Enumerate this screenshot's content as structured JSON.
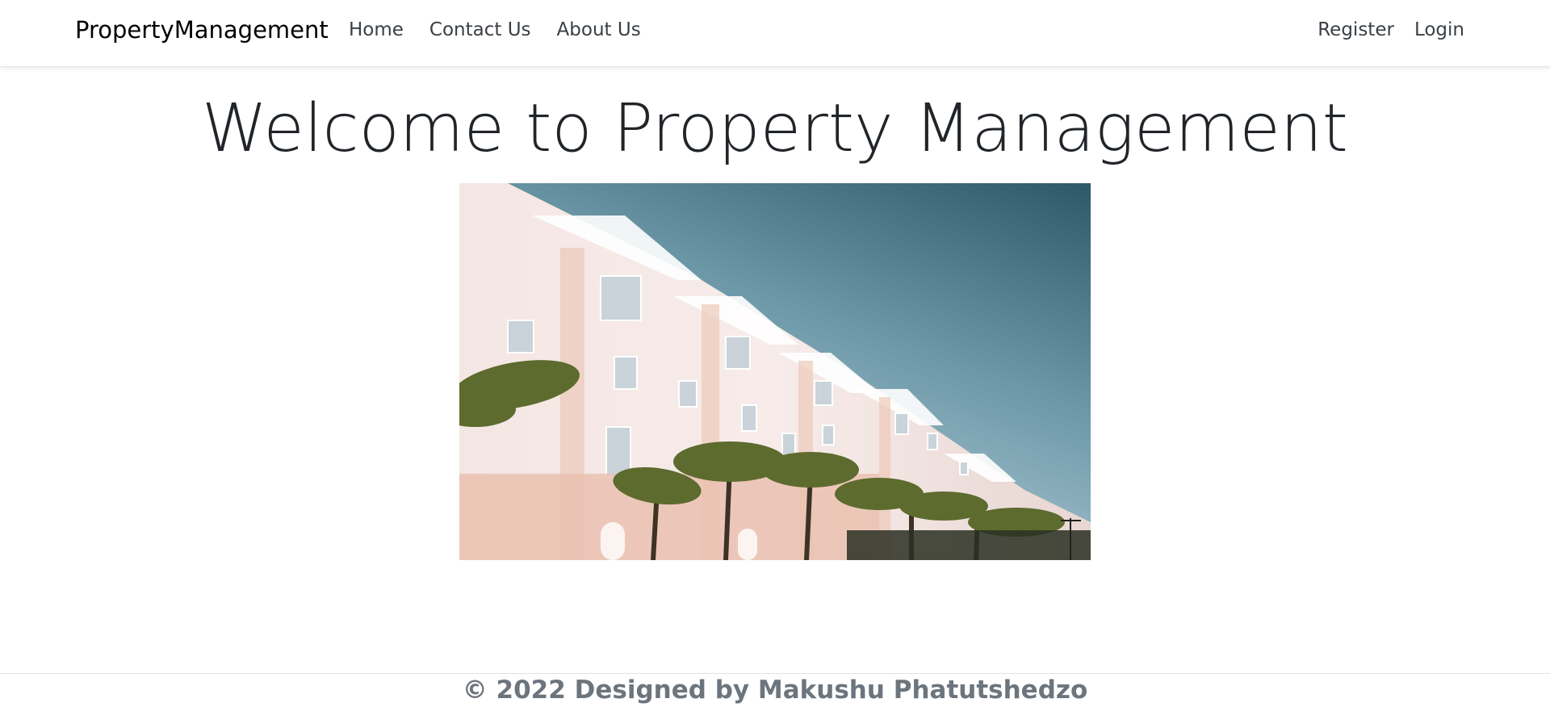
{
  "navbar": {
    "brand": "PropertyManagement",
    "left_links": [
      "Home",
      "Contact Us",
      "About Us"
    ],
    "right_links": [
      "Register",
      "Login"
    ]
  },
  "main": {
    "title": "Welcome to Property Management",
    "image_alt": "building-facade-photo"
  },
  "footer": {
    "text": "© 2022 Designed by Makushu Phatutshedzo"
  },
  "colors": {
    "brand_text": "#000000",
    "nav_link": "#3a3f44",
    "footer_text": "#6c757d",
    "sky": "#5f8fa0",
    "building": "#f2e4e1"
  }
}
